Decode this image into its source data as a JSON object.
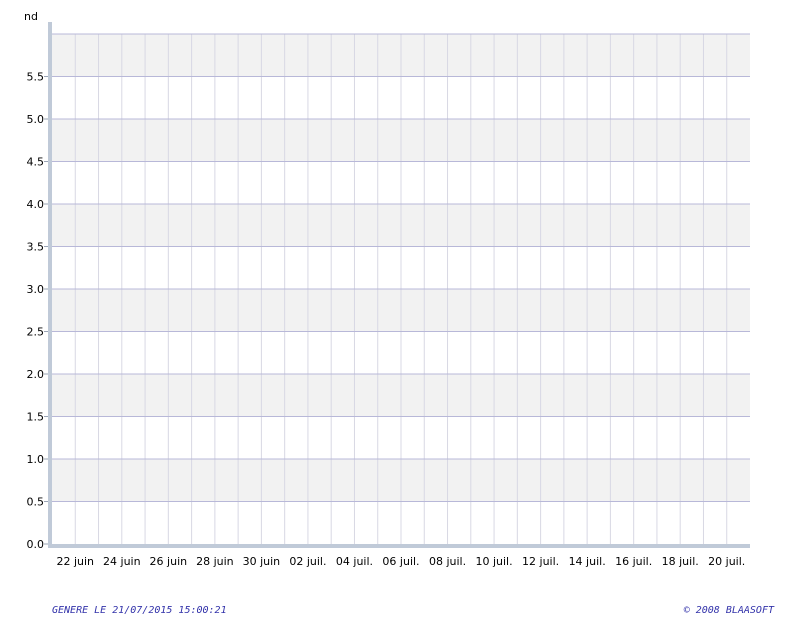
{
  "chart_data": {
    "type": "line",
    "ylabel": "nd",
    "ylim": [
      0,
      6
    ],
    "y_ticks": [
      "0.0",
      "0.5",
      "1.0",
      "1.5",
      "2.0",
      "2.5",
      "3.0",
      "3.5",
      "4.0",
      "4.5",
      "5.0",
      "5.5"
    ],
    "y_tick_values": [
      0,
      0.5,
      1,
      1.5,
      2,
      2.5,
      3,
      3.5,
      4,
      4.5,
      5,
      5.5
    ],
    "x_ticks": [
      "22 juin",
      "24 juin",
      "26 juin",
      "28 juin",
      "30 juin",
      "02 juil.",
      "04 juil.",
      "06 juil.",
      "08 juil.",
      "10 juil.",
      "12 juil.",
      "14 juil.",
      "16 juil.",
      "18 juil.",
      "20 juil."
    ],
    "x_range": [
      "2015-06-21",
      "2015-07-21"
    ],
    "x_tick_dates": [
      "2015-06-22",
      "2015-06-24",
      "2015-06-26",
      "2015-06-28",
      "2015-06-30",
      "2015-07-02",
      "2015-07-04",
      "2015-07-06",
      "2015-07-08",
      "2015-07-10",
      "2015-07-12",
      "2015-07-14",
      "2015-07-16",
      "2015-07-18",
      "2015-07-20"
    ],
    "series": [],
    "grid": true,
    "band_color": "#f2f2f2",
    "grid_color": "#b8b8d8",
    "axis_color": "#c0cad8"
  },
  "footer": {
    "left": "GENERE LE 21/07/2015 15:00:21",
    "right": "© 2008 BLAASOFT"
  }
}
